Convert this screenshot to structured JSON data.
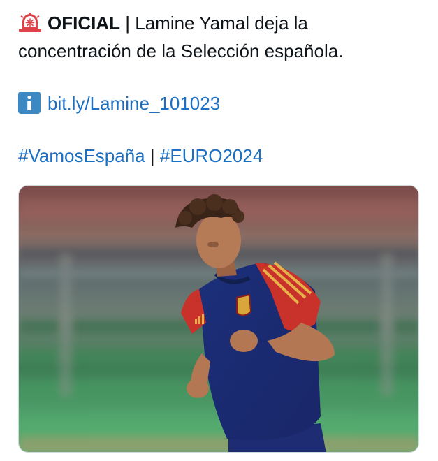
{
  "tweet": {
    "line1": {
      "emoji": "police-siren-icon",
      "strong": "OFICIAL",
      "separator": "|",
      "text": "Lamine Yamal deja la"
    },
    "line2": "concentración de la Selección española.",
    "link": {
      "emoji": "information-icon",
      "text": "bit.ly/Lamine_101023"
    },
    "hashtags": [
      "#VamosEspaña",
      "#EURO2024"
    ],
    "hashtag_separator": "|"
  },
  "media": {
    "type": "photo"
  },
  "colors": {
    "text": "#0f1419",
    "link": "#1d6fc2",
    "border": "#cfd9de"
  }
}
